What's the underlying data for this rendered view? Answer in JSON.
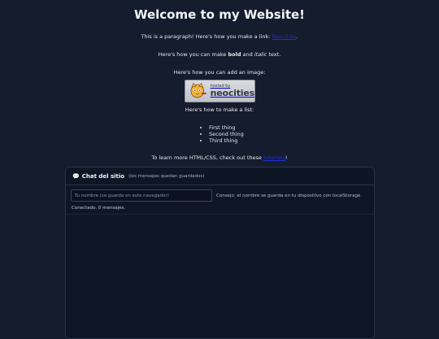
{
  "page": {
    "title": "Welcome to my Website!",
    "para": {
      "text": "This is a paragraph! Here's how you make a link: ",
      "link": "Neocities",
      "end": "."
    },
    "format": {
      "pre": "Here's how you can make ",
      "bold": "bold",
      "mid": " and ",
      "italic": "italic",
      "post": " text."
    },
    "image_line": "Here's how you can add an image:",
    "badge": {
      "small": "hosted by",
      "big": "neocities"
    },
    "list_line": "Here's how to make a list:",
    "list": [
      "First thing",
      "Second thing",
      "Third thing"
    ],
    "learn": {
      "pre": "To learn more HTML/CSS, check out these ",
      "link": "tutorials",
      "post": "!"
    }
  },
  "chat": {
    "icon": "speech-bubble-icon",
    "emoji": "💬",
    "title": "Chat del sitio",
    "subtitle": "(los mensajes quedan guardados)",
    "name_placeholder": "Tu nombre (se guarda en este navegador)",
    "name_value": "",
    "tip": "Consejo: el nombre se guarda en tu dispositivo con localStorage.",
    "status": "Conectado. 0 mensajes."
  },
  "colors": {
    "background": "#141c2d",
    "link": "#1f2fd6",
    "chat_panel": "#0e1524"
  }
}
